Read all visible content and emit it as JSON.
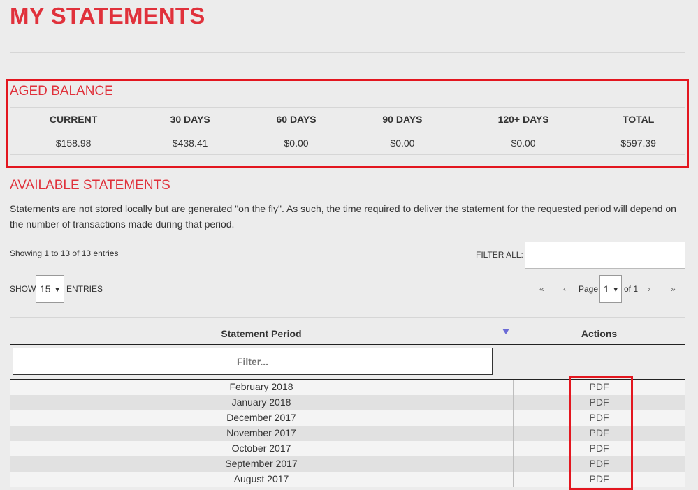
{
  "page": {
    "title": "MY STATEMENTS"
  },
  "aged_balance": {
    "heading": "AGED BALANCE",
    "columns": [
      "CURRENT",
      "30 DAYS",
      "60 DAYS",
      "90 DAYS",
      "120+ DAYS",
      "TOTAL"
    ],
    "values": [
      "$158.98",
      "$438.41",
      "$0.00",
      "$0.00",
      "$0.00",
      "$597.39"
    ]
  },
  "available": {
    "heading": "AVAILABLE STATEMENTS",
    "description": "Statements are not stored locally but are generated \"on the fly\". As such, the time required to deliver the statement for the requested period will depend on the number of transactions made during that period.",
    "showing": "Showing 1 to 13 of 13 entries",
    "filter_all_label": "FILTER ALL:",
    "filter_all_value": "",
    "show_label": "SHOW",
    "show_value": "15",
    "entries_label": "ENTRIES",
    "pager": {
      "first": "«",
      "prev": "‹",
      "page_label": "Page",
      "page_value": "1",
      "of_label": "of 1",
      "next": "›",
      "last": "»"
    },
    "table": {
      "col_period": "Statement Period",
      "col_actions": "Actions",
      "filter_placeholder": "Filter...",
      "rows": [
        {
          "period": "February 2018",
          "action": "PDF"
        },
        {
          "period": "January 2018",
          "action": "PDF"
        },
        {
          "period": "December 2017",
          "action": "PDF"
        },
        {
          "period": "November 2017",
          "action": "PDF"
        },
        {
          "period": "October 2017",
          "action": "PDF"
        },
        {
          "period": "September 2017",
          "action": "PDF"
        },
        {
          "period": "August 2017",
          "action": "PDF"
        }
      ]
    }
  },
  "colors": {
    "accent": "#e0313b",
    "highlight_border": "#e3161f",
    "sort_icon": "#6b6bd6"
  },
  "icons": {
    "sort": "sort-desc-icon",
    "dropdown": "caret-down-icon"
  }
}
